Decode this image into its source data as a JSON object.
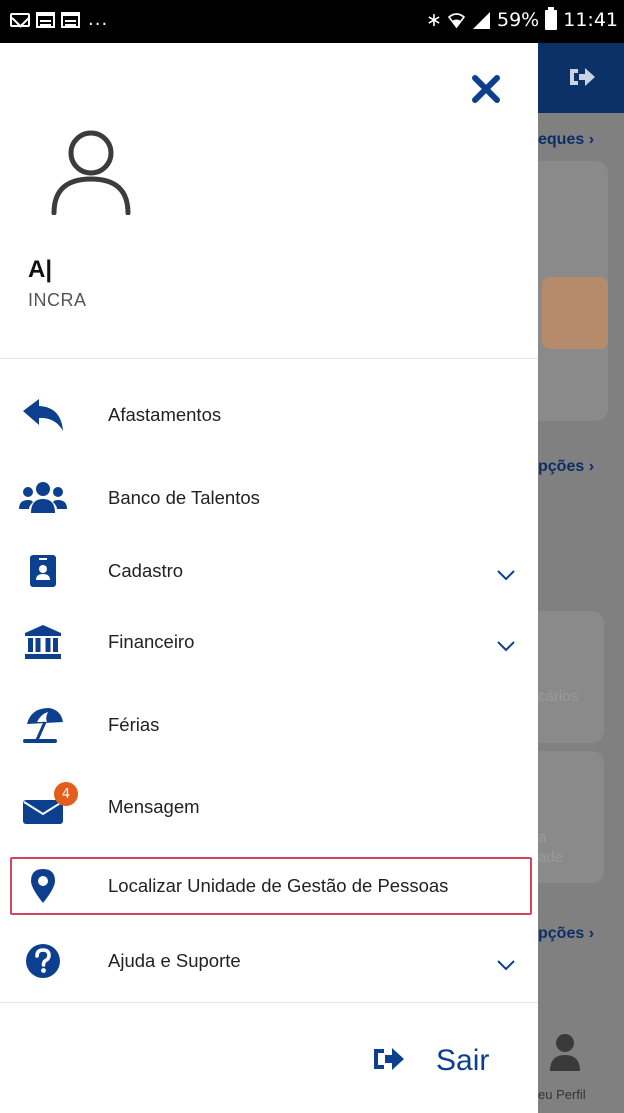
{
  "status_bar": {
    "battery": "59%",
    "time": "11:41",
    "overflow": "..."
  },
  "drawer": {
    "user": {
      "name": "A|",
      "org": "INCRA"
    },
    "menu": [
      {
        "label": "Afastamentos",
        "icon": "reply-arrow-icon",
        "has_chevron": false
      },
      {
        "label": "Banco de Talentos",
        "icon": "people-group-icon",
        "has_chevron": false
      },
      {
        "label": "Cadastro",
        "icon": "id-badge-icon",
        "has_chevron": true
      },
      {
        "label": "Financeiro",
        "icon": "bank-building-icon",
        "has_chevron": true
      },
      {
        "label": "Férias",
        "icon": "beach-umbrella-icon",
        "has_chevron": false
      },
      {
        "label": "Mensagem",
        "icon": "envelope-icon",
        "has_chevron": false,
        "badge": "4"
      },
      {
        "label": "Localizar Unidade de Gestão de Pessoas",
        "icon": "map-pin-icon",
        "has_chevron": false,
        "highlighted": true
      },
      {
        "label": "Ajuda e Suporte",
        "icon": "question-circle-icon",
        "has_chevron": true
      }
    ],
    "logout_label": "Sair"
  },
  "background_app": {
    "link_top": "eques",
    "link_mid": "pções",
    "muted_1": "cários",
    "muted_2a": "a",
    "muted_2b": "ade",
    "link_bottom": "pções",
    "profile_label": "eu Perfil"
  },
  "colors": {
    "primary": "#0d3f8f",
    "header": "#0c3166",
    "badge": "#e35d1b",
    "highlight_border": "#d3455a"
  }
}
